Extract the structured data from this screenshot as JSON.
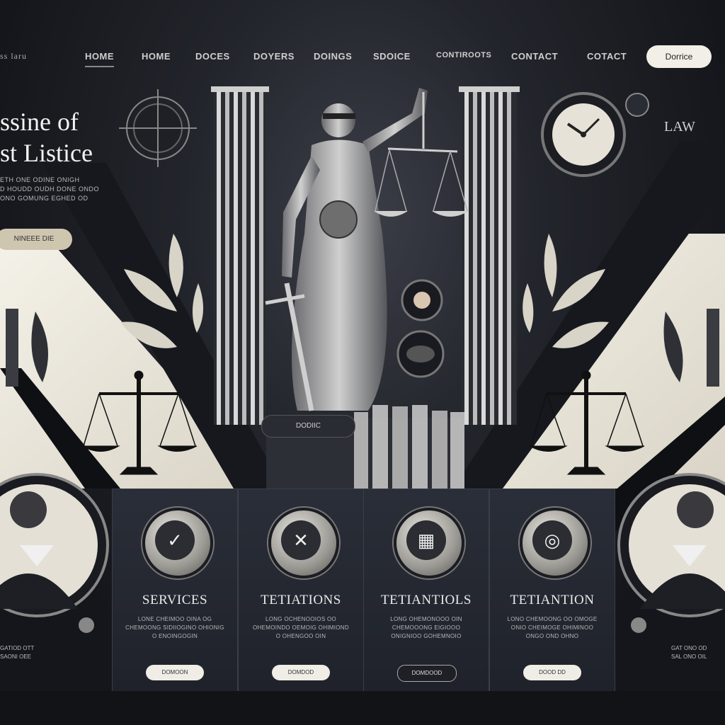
{
  "nav": {
    "logo": "ss laru",
    "links": [
      "HOME",
      "HOME",
      "DOCES",
      "DOYERS",
      "DOINGS",
      "SDOICE",
      "CONTIROOTS",
      "CONTACT",
      "COTACT"
    ],
    "cta": "Dorrice"
  },
  "hero": {
    "title_line1": "ssine of",
    "title_line2": "st Listice",
    "subtitle_line1": "ETH ONE ODINE ONIGH",
    "subtitle_line2": "D HOUDD OUDH DONE ONDO",
    "subtitle_line3": "ONO GOMUNG EGHED OD",
    "button": "NINEEE DIE",
    "side_label": "LAW"
  },
  "center": {
    "pill": "DODIIC"
  },
  "left_caption": {
    "line1": "GATIOD OTT",
    "line2": "SAONI OEE"
  },
  "right_caption": {
    "line1": "GAT ONO OD",
    "line2": "SAL ONO OIL"
  },
  "cards": [
    {
      "title": "SERVICES",
      "icon": "gavel-icon",
      "glyph": "✓",
      "text": "LONE CHEIMOO OINA OG CHEMOONG SIDIIOGINO OHIONIG O ENOINGOGIN",
      "button": "DOMOON"
    },
    {
      "title": "TETIATIONS",
      "icon": "crossed-swords-icon",
      "glyph": "✕",
      "text": "LONG OCHENOOIOS OO OHEMOINDO OEMOIG OHIMIOND O OHENGOO OIN",
      "button": "DOMDOD"
    },
    {
      "title": "TETIANTIOLS",
      "icon": "calendar-grid-icon",
      "glyph": "▦",
      "text": "LONG OHEMONOOO OIN CHEMOOONG EIGIOOO ONIGNIOO GOHEMNOIO",
      "button": "DOMDOOD"
    },
    {
      "title": "TETIANTION",
      "icon": "shield-icon",
      "glyph": "◎",
      "text": "LONO CHEMOONG OO OMOGE ONIO CHEIMOGE OHIMINOO ONGO OND OHNO",
      "button": "DOOD DD"
    }
  ],
  "colors": {
    "accent": "#f2efe6",
    "panel": "#2a2e38",
    "cream": "#ece8dc"
  }
}
